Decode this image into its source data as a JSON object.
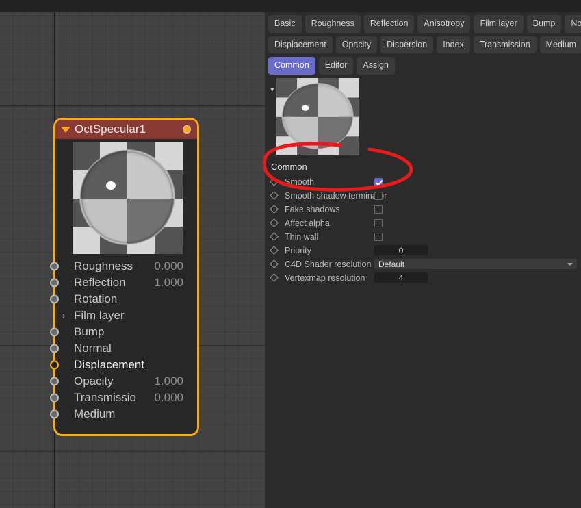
{
  "node_editor": {
    "node": {
      "title": "OctSpecular1",
      "collapse_icon": "triangle-down-icon",
      "status_dot": "orange-dot-icon",
      "preview": "material-sphere-checker-preview",
      "ports": [
        {
          "label": "Roughness",
          "value": "0.000",
          "knob": "grey",
          "arrow": false,
          "bold": false
        },
        {
          "label": "Reflection",
          "value": "1.000",
          "knob": "grey",
          "arrow": false,
          "bold": false
        },
        {
          "label": "Rotation",
          "value": "",
          "knob": "grey",
          "arrow": false,
          "bold": false
        },
        {
          "label": "Film layer",
          "value": "",
          "knob": "none",
          "arrow": true,
          "bold": false
        },
        {
          "label": "Bump",
          "value": "",
          "knob": "grey",
          "arrow": false,
          "bold": false
        },
        {
          "label": "Normal",
          "value": "",
          "knob": "grey",
          "arrow": false,
          "bold": false
        },
        {
          "label": "Displacement",
          "value": "",
          "knob": "orange",
          "arrow": false,
          "bold": true
        },
        {
          "label": "Opacity",
          "value": "1.000",
          "knob": "grey",
          "arrow": false,
          "bold": false
        },
        {
          "label": "Transmissio",
          "value": "0.000",
          "knob": "grey",
          "arrow": false,
          "bold": false
        },
        {
          "label": "Medium",
          "value": "",
          "knob": "grey",
          "arrow": false,
          "bold": false
        }
      ]
    }
  },
  "properties": {
    "tab_rows": [
      [
        "Basic",
        "Roughness",
        "Reflection",
        "Anisotropy",
        "Film layer",
        "Bump",
        "Normal"
      ],
      [
        "Displacement",
        "Opacity",
        "Dispersion",
        "Index",
        "Transmission",
        "Medium"
      ],
      [
        "Common",
        "Editor",
        "Assign"
      ]
    ],
    "selected_tab": "Common",
    "preview": {
      "collapse_icon": "chevron-down-icon",
      "thumbnail": "material-sphere-checker-preview"
    },
    "section_title": "Common",
    "rows": [
      {
        "label": "Smooth",
        "control": "checkbox",
        "checked": true,
        "value": ""
      },
      {
        "label": "Smooth shadow terminator",
        "control": "checkbox",
        "checked": false,
        "value": ""
      },
      {
        "label": "Fake shadows",
        "control": "checkbox",
        "checked": false,
        "value": ""
      },
      {
        "label": "Affect alpha",
        "control": "checkbox",
        "checked": false,
        "value": ""
      },
      {
        "label": "Thin wall",
        "control": "checkbox",
        "checked": false,
        "value": ""
      },
      {
        "label": "Priority",
        "control": "number",
        "checked": false,
        "value": "0"
      },
      {
        "label": "C4D Shader resolution",
        "control": "select",
        "checked": false,
        "value": "Default"
      },
      {
        "label": "Vertexmap resolution",
        "control": "number",
        "checked": false,
        "value": "4"
      }
    ]
  },
  "annotation": {
    "shape": "red-ellipse-highlight",
    "color": "#e81a1a"
  },
  "colors": {
    "node_header": "#8a3a35",
    "node_border": "#ffab10",
    "accent_selected_tab": "#6b6bc9",
    "checkbox_checked": "#6b6bd8",
    "canvas": "#434343",
    "panel": "#2b2b2b"
  }
}
